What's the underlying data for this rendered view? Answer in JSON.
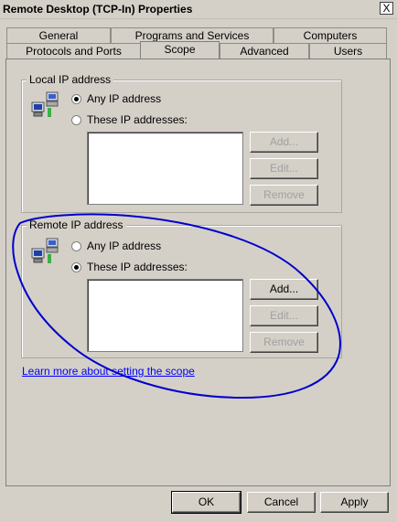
{
  "window": {
    "title": "Remote Desktop (TCP-In) Properties",
    "close_glyph": "X"
  },
  "tabs": {
    "row1": [
      "General",
      "Programs and Services",
      "Computers"
    ],
    "row2": [
      "Protocols and Ports",
      "Scope",
      "Advanced",
      "Users"
    ],
    "active": "Scope"
  },
  "local": {
    "legend": "Local IP address",
    "option_any": "Any IP address",
    "option_these": "These IP addresses:",
    "selected": "any",
    "buttons": {
      "add": "Add...",
      "edit": "Edit...",
      "remove": "Remove"
    }
  },
  "remote": {
    "legend": "Remote IP address",
    "option_any": "Any IP address",
    "option_these": "These IP addresses:",
    "selected": "these",
    "buttons": {
      "add": "Add...",
      "edit": "Edit...",
      "remove": "Remove"
    }
  },
  "learn_more": "Learn more about setting the scope",
  "footer": {
    "ok": "OK",
    "cancel": "Cancel",
    "apply": "Apply"
  },
  "annotation_color": "#0000cc"
}
